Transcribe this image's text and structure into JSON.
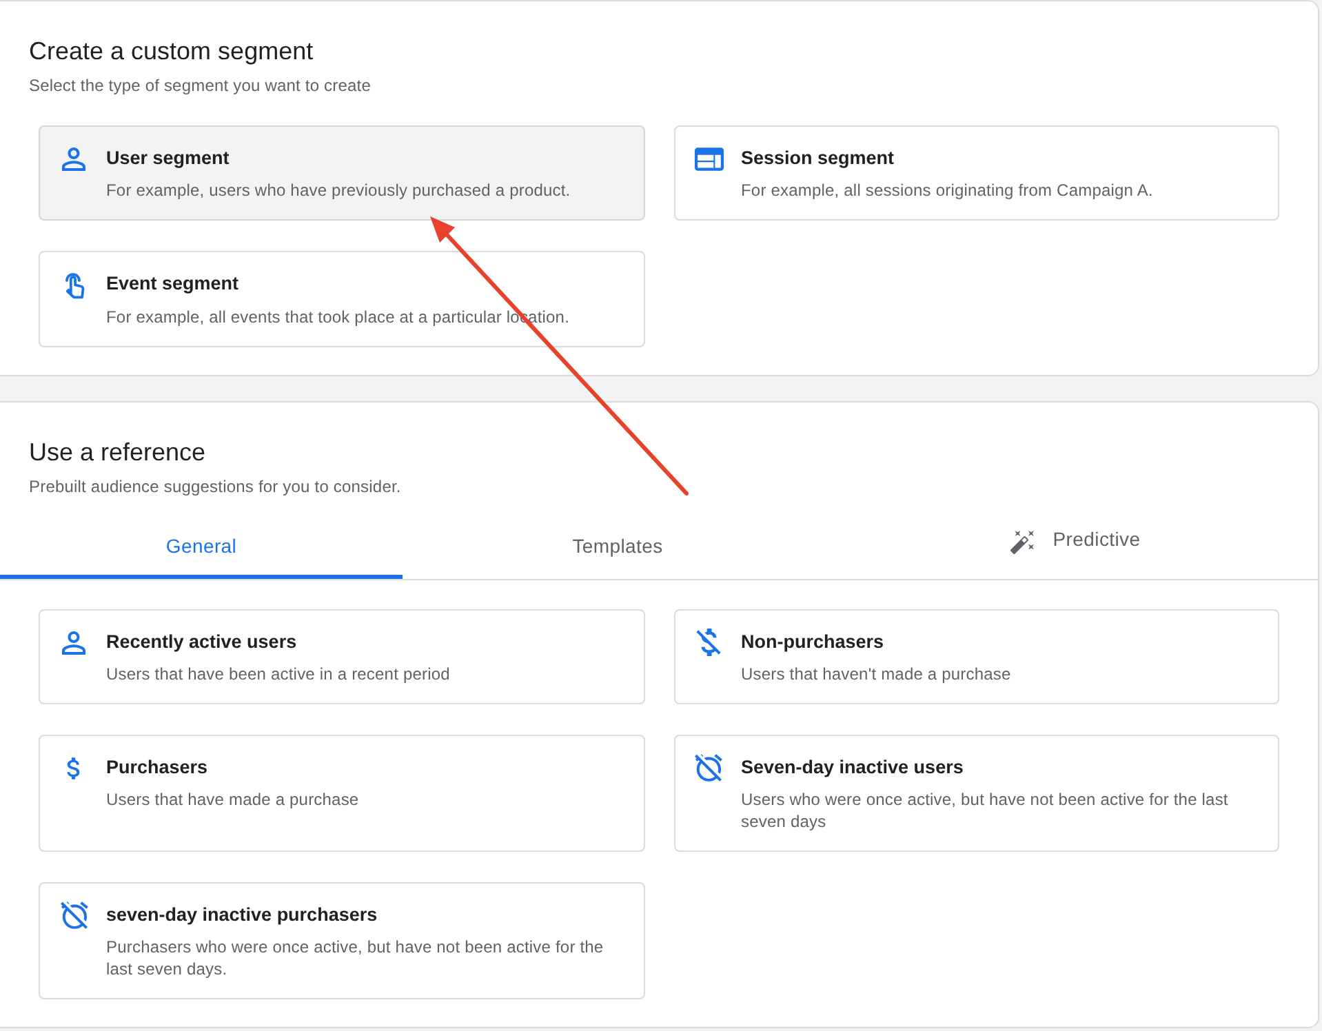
{
  "custom_segment": {
    "title": "Create a custom segment",
    "subtitle": "Select the type of segment you want to create",
    "options": [
      {
        "kind": "user",
        "title": "User segment",
        "description": "For example, users who have previously purchased a product.",
        "hovered": true
      },
      {
        "kind": "session",
        "title": "Session segment",
        "description": "For example, all sessions originating from Campaign A.",
        "hovered": false
      },
      {
        "kind": "event",
        "title": "Event segment",
        "description": "For example, all events that took place at a particular location.",
        "hovered": false
      }
    ]
  },
  "reference": {
    "title": "Use a reference",
    "subtitle": "Prebuilt audience suggestions for you to consider.",
    "tabs": [
      {
        "kind": "text",
        "label": "General",
        "selected": true
      },
      {
        "kind": "text",
        "label": "Templates",
        "selected": false
      },
      {
        "kind": "icon",
        "label": "Predictive",
        "selected": false
      }
    ],
    "suggestions": [
      {
        "kind": "active",
        "title": "Recently active users",
        "description": "Users that have been active in a recent period"
      },
      {
        "kind": "nonpurchaser",
        "title": "Non-purchasers",
        "description": "Users that haven't made a purchase"
      },
      {
        "kind": "purchaser",
        "title": "Purchasers",
        "description": "Users that have made a purchase"
      },
      {
        "kind": "inactive",
        "title": "Seven-day inactive users",
        "description": "Users who were once active, but have not been active for the last seven days"
      },
      {
        "kind": "inactive",
        "title": "seven-day inactive purchasers",
        "description": "Purchasers who were once active, but have not been active for the last seven days."
      }
    ]
  },
  "annotations": [
    {
      "kind": "arrow"
    }
  ]
}
